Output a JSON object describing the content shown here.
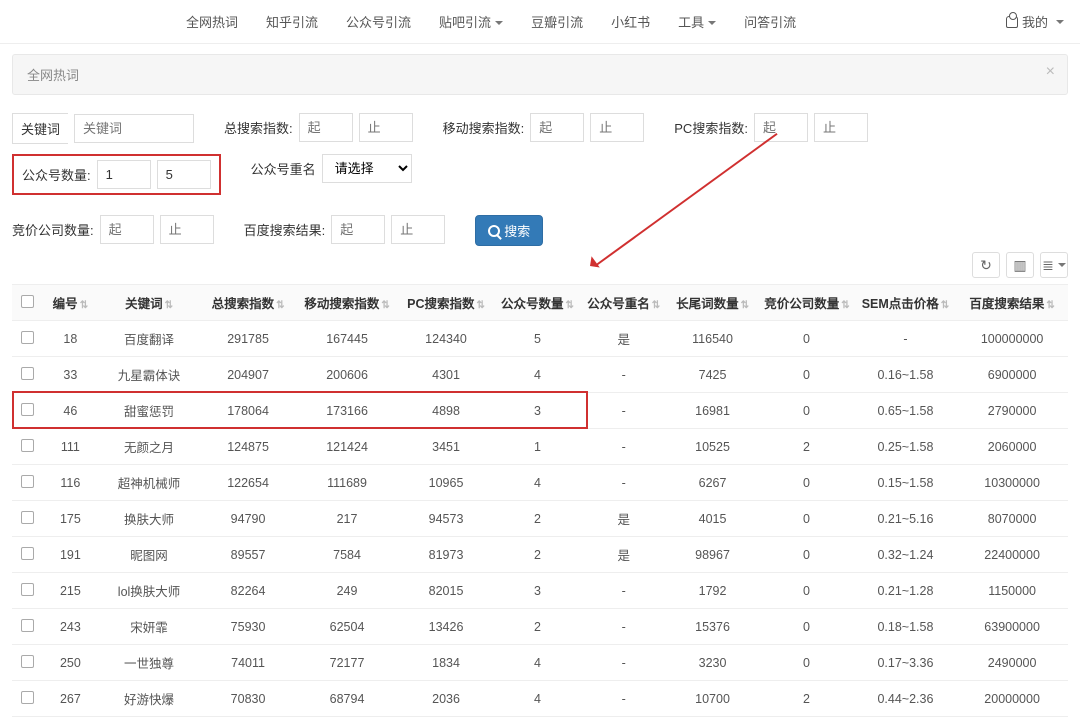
{
  "nav": {
    "items": [
      "全网热词",
      "知乎引流",
      "公众号引流",
      "贴吧引流",
      "豆瓣引流",
      "小红书",
      "工具",
      "问答引流"
    ],
    "has_caret": [
      false,
      false,
      false,
      true,
      false,
      false,
      true,
      false
    ],
    "user_label": "我的"
  },
  "banner": {
    "title": "全网热词"
  },
  "filters": {
    "keyword_label": "关键词",
    "keyword_ph": "关键词",
    "total_idx_label": "总搜索指数:",
    "mobile_idx_label": "移动搜索指数:",
    "pc_idx_label": "PC搜索指数:",
    "gzh_count_label": "公众号数量:",
    "gzh_count_from": "1",
    "gzh_count_to": "5",
    "gzh_dup_label": "公众号重名",
    "gzh_dup_select_ph": "请选择",
    "bidco_label": "竞价公司数量:",
    "baidu_results_label": "百度搜索结果:",
    "from_ph": "起",
    "to_ph": "止",
    "search_btn": "搜索"
  },
  "tools": {
    "refresh": "↻",
    "cols": "▥",
    "view": "≣"
  },
  "table": {
    "headers": [
      "",
      "编号",
      "关键词",
      "总搜索指数",
      "移动搜索指数",
      "PC搜索指数",
      "公众号数量",
      "公众号重名",
      "长尾词数量",
      "竞价公司数量",
      "SEM点击价格",
      "百度搜索结果"
    ],
    "rows": [
      {
        "id": "18",
        "kw": "百度翻译",
        "total": "291785",
        "mobile": "167445",
        "pc": "124340",
        "gzh": "5",
        "dup": "是",
        "long": "116540",
        "bid": "0",
        "sem": "-",
        "baidu": "100000000"
      },
      {
        "id": "33",
        "kw": "九星霸体诀",
        "total": "204907",
        "mobile": "200606",
        "pc": "4301",
        "gzh": "4",
        "dup": "-",
        "long": "7425",
        "bid": "0",
        "sem": "0.16~1.58",
        "baidu": "6900000"
      },
      {
        "id": "46",
        "kw": "甜蜜惩罚",
        "total": "178064",
        "mobile": "173166",
        "pc": "4898",
        "gzh": "3",
        "dup": "-",
        "long": "16981",
        "bid": "0",
        "sem": "0.65~1.58",
        "baidu": "2790000"
      },
      {
        "id": "111",
        "kw": "无颜之月",
        "total": "124875",
        "mobile": "121424",
        "pc": "3451",
        "gzh": "1",
        "dup": "-",
        "long": "10525",
        "bid": "2",
        "sem": "0.25~1.58",
        "baidu": "2060000"
      },
      {
        "id": "116",
        "kw": "超神机械师",
        "total": "122654",
        "mobile": "111689",
        "pc": "10965",
        "gzh": "4",
        "dup": "-",
        "long": "6267",
        "bid": "0",
        "sem": "0.15~1.58",
        "baidu": "10300000"
      },
      {
        "id": "175",
        "kw": "换肤大师",
        "total": "94790",
        "mobile": "217",
        "pc": "94573",
        "gzh": "2",
        "dup": "是",
        "long": "4015",
        "bid": "0",
        "sem": "0.21~5.16",
        "baidu": "8070000"
      },
      {
        "id": "191",
        "kw": "昵图网",
        "total": "89557",
        "mobile": "7584",
        "pc": "81973",
        "gzh": "2",
        "dup": "是",
        "long": "98967",
        "bid": "0",
        "sem": "0.32~1.24",
        "baidu": "22400000"
      },
      {
        "id": "215",
        "kw": "lol换肤大师",
        "total": "82264",
        "mobile": "249",
        "pc": "82015",
        "gzh": "3",
        "dup": "-",
        "long": "1792",
        "bid": "0",
        "sem": "0.21~1.28",
        "baidu": "1150000"
      },
      {
        "id": "243",
        "kw": "宋妍霏",
        "total": "75930",
        "mobile": "62504",
        "pc": "13426",
        "gzh": "2",
        "dup": "-",
        "long": "15376",
        "bid": "0",
        "sem": "0.18~1.58",
        "baidu": "63900000"
      },
      {
        "id": "250",
        "kw": "一世独尊",
        "total": "74011",
        "mobile": "72177",
        "pc": "1834",
        "gzh": "4",
        "dup": "-",
        "long": "3230",
        "bid": "0",
        "sem": "0.17~3.36",
        "baidu": "2490000"
      },
      {
        "id": "267",
        "kw": "好游快爆",
        "total": "70830",
        "mobile": "68794",
        "pc": "2036",
        "gzh": "4",
        "dup": "-",
        "long": "10700",
        "bid": "2",
        "sem": "0.44~2.36",
        "baidu": "20000000"
      }
    ],
    "highlight_row_index": 2
  },
  "annotation": {
    "color": "#d03030"
  }
}
